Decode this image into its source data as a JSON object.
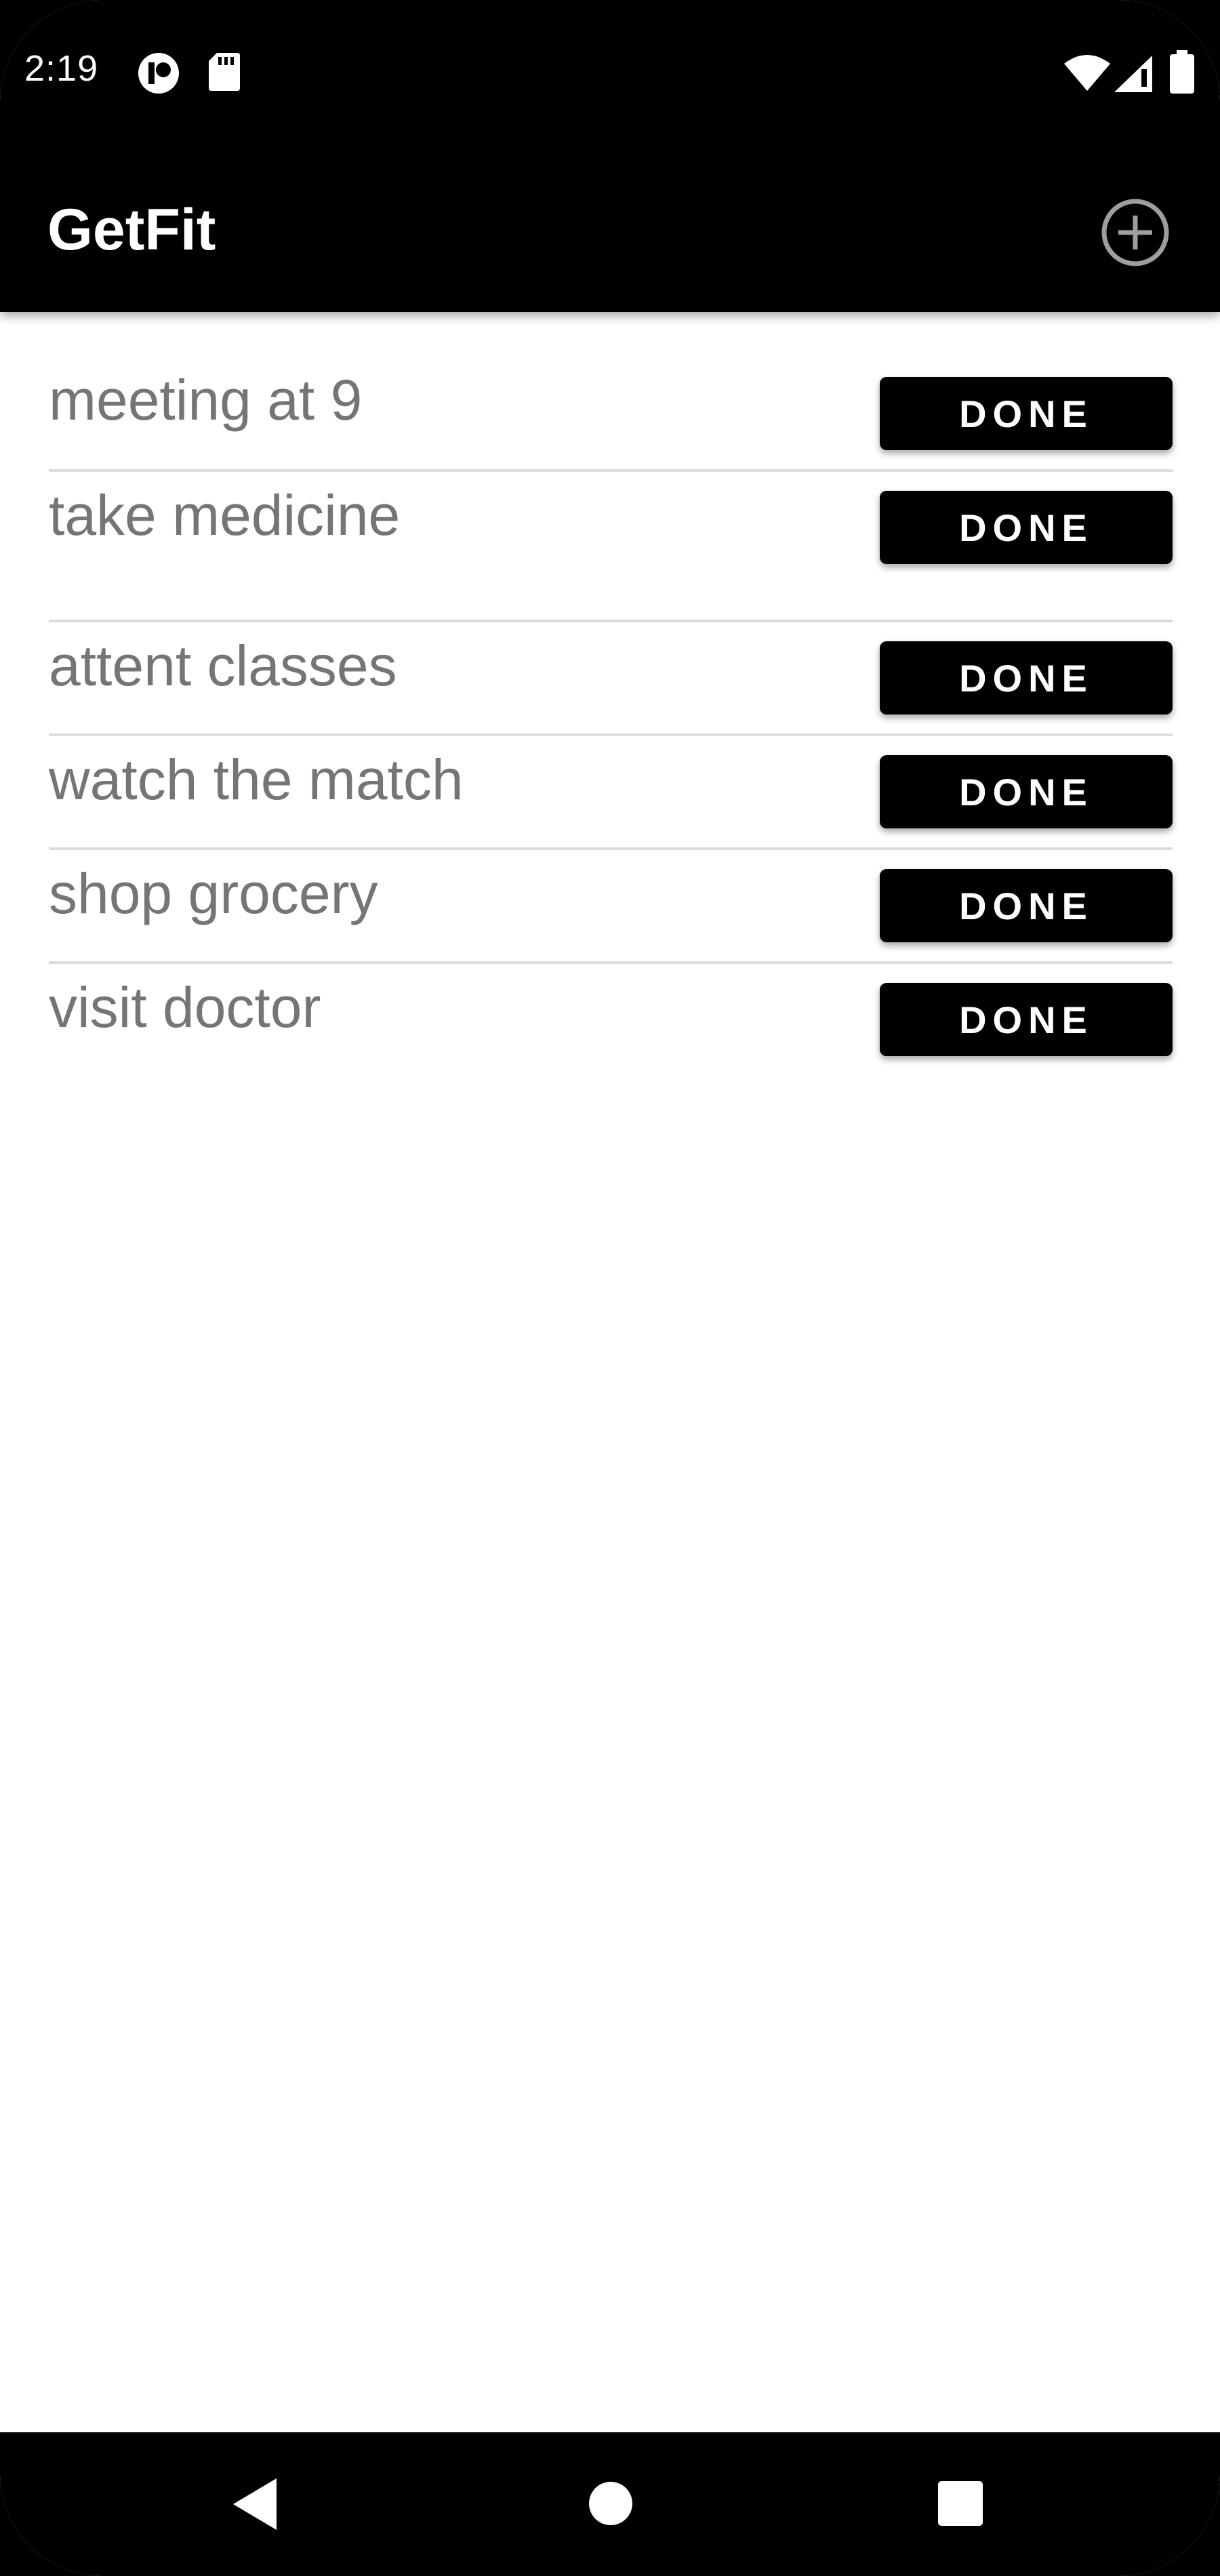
{
  "status_bar": {
    "time": "2:19",
    "icons": [
      "app-notification-icon",
      "sd-card-icon",
      "wifi-icon",
      "cell-signal-icon",
      "battery-icon"
    ]
  },
  "app_bar": {
    "title": "GetFit",
    "add_icon": "add-circle-icon"
  },
  "tasks": [
    {
      "label": "meeting at 9",
      "button": "DONE"
    },
    {
      "label": "take medicine",
      "button": "DONE"
    },
    {
      "label": "attent classes",
      "button": "DONE"
    },
    {
      "label": "watch the match",
      "button": "DONE"
    },
    {
      "label": "shop grocery",
      "button": "DONE"
    },
    {
      "label": "visit doctor",
      "button": "DONE"
    }
  ],
  "nav_bar": {
    "icons": [
      "back-icon",
      "home-icon",
      "recents-icon"
    ]
  },
  "colors": {
    "bar_background": "#000000",
    "content_background": "#ffffff",
    "task_text": "#757575",
    "button_background": "#000000",
    "button_text": "#ffffff",
    "divider": "#dcdcdc"
  }
}
